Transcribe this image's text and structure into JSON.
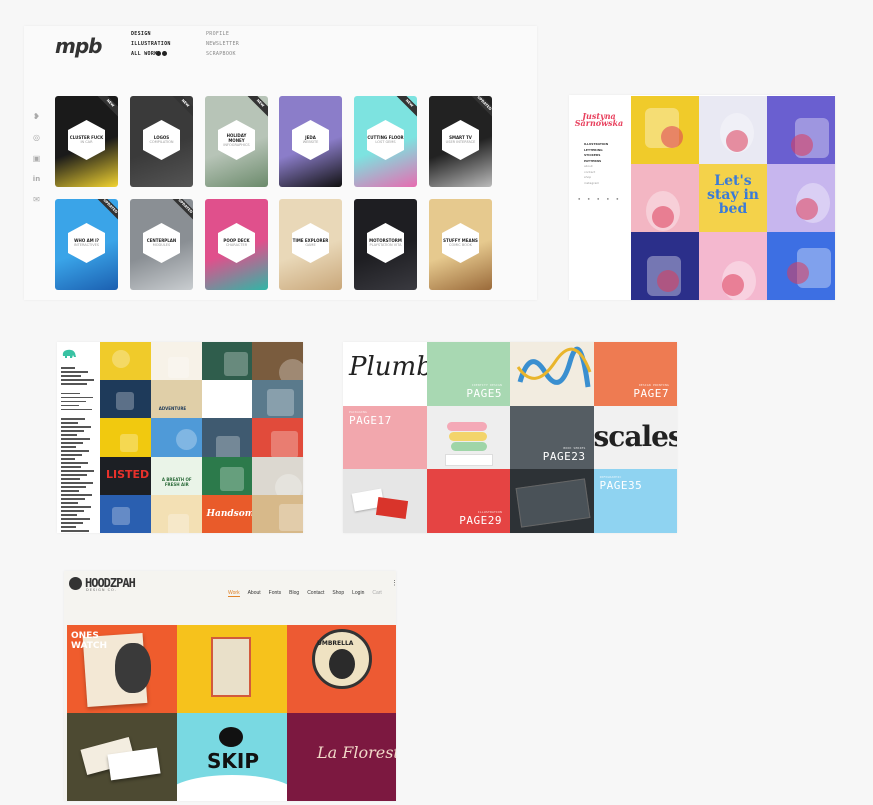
{
  "mpb": {
    "logo": "mpb",
    "nav_left": [
      "DESIGN",
      "ILLUSTRATION",
      "ALL WORK"
    ],
    "nav_right": [
      "PROFILE",
      "NEWSLETTER",
      "SCRAPBOOK"
    ],
    "social_icons": [
      "twitter-icon",
      "dribbble-icon",
      "instagram-icon",
      "linkedin-icon",
      "mail-icon"
    ],
    "tiles": [
      {
        "title": "CLUSTER FUCK",
        "subtitle": "IN CAR",
        "badge": "NEW",
        "color": "#1a1a1a",
        "accent": "#f2d431"
      },
      {
        "title": "LOGOS",
        "subtitle": "COMPILATION",
        "badge": "NEW",
        "color": "#3a3a3a",
        "accent": "#555555"
      },
      {
        "title": "HOLIDAY MONEY",
        "subtitle": "INFOGRAPHICS",
        "badge": "NEW",
        "color": "#b7c4b7",
        "accent": "#6b8a6b"
      },
      {
        "title": "JEDA",
        "subtitle": "WEBSITE",
        "badge": "",
        "color": "#8b7dc9",
        "accent": "#111111"
      },
      {
        "title": "CUTTING FLOOR",
        "subtitle": "LOST GEMS",
        "badge": "NEW",
        "color": "#7de3e0",
        "accent": "#e86bb0"
      },
      {
        "title": "SMART TV",
        "subtitle": "USER INTERFACE",
        "badge": "UPDATED",
        "color": "#222222",
        "accent": "#bbbbbb"
      },
      {
        "title": "WHO AM I?",
        "subtitle": "INTERACTIVES",
        "badge": "UPDATED",
        "color": "#3aa4e8",
        "accent": "#1b5fb0"
      },
      {
        "title": "CENTERPLAN",
        "subtitle": "MODULES",
        "badge": "UPDATED",
        "color": "#8a8f94",
        "accent": "#c9cdd0"
      },
      {
        "title": "POOP DECK",
        "subtitle": "CHARACTER",
        "badge": "",
        "color": "#e0508c",
        "accent": "#2fb7a6"
      },
      {
        "title": "TIME EXPLORER",
        "subtitle": "GAME",
        "badge": "",
        "color": "#e9d8b8",
        "accent": "#c9a77a"
      },
      {
        "title": "MOTORSTORM",
        "subtitle": "PLAYSTATION VITA",
        "badge": "",
        "color": "#1e1e22",
        "accent": "#3a3a40"
      },
      {
        "title": "STUFFY MEANS",
        "subtitle": "COMIC BOOK",
        "badge": "",
        "color": "#e6c98e",
        "accent": "#9a6a3a"
      }
    ]
  },
  "illustrator": {
    "logo": "Justyna Sarnowska",
    "menu": [
      "ILLUSTRATION",
      "LETTERING",
      "STICKERS",
      "PATTERNS",
      "about",
      "contact",
      "shop",
      "instagram"
    ],
    "lettering": "Let's stay in bed",
    "tiles": [
      "#f0cb2a",
      "#e9e9f3",
      "#6a5fd0",
      "#f3b6c3",
      "#f4d24a",
      "#c7b6ee",
      "#2b2f8a",
      "#f4b8cf",
      "#3d6fe3"
    ]
  },
  "grid_site": {
    "tiles": [
      "#f0cb2a",
      "#f7f2e8",
      "#2f5d4c",
      "#7a5c3e",
      "#1e3a5a",
      "#e0cfa8",
      "#ffffff",
      "#5a7a8c",
      "#f1c90f",
      "#4f9ad8",
      "#3f5a70",
      "#e14b3b",
      "#1c1f24",
      "#eaf4e8",
      "#2c7a4b",
      "#dcd8d0",
      "#2a5fb0",
      "#f3e0b4",
      "#e95b2a",
      "#d7b98a"
    ],
    "text_a": "LISTED",
    "text_b": "A BREATH OF FRESH AIR",
    "text_c": "ADVENTURE",
    "text_d": "Handsome"
  },
  "pages": {
    "signature": "Plumbs",
    "word": "scales",
    "items": [
      {
        "label": "PAGE5",
        "color": "#a8d8b2"
      },
      {
        "label": "PAGE7",
        "color": "#ee7b52"
      },
      {
        "label": "PAGE17",
        "color": "#f2a7ad"
      },
      {
        "label": "PAGE23",
        "color": "#555d63"
      },
      {
        "label": "PAGE29",
        "color": "#e54443"
      },
      {
        "label": "PAGE35",
        "color": "#8fd3f1"
      }
    ]
  },
  "hoodzpah": {
    "logo": "HOODZPAH",
    "logo_sub": "DESIGN CO.",
    "nav": [
      "Work",
      "About",
      "Fonts",
      "Blog",
      "Contact",
      "Shop",
      "Login",
      "Cart"
    ],
    "tiles": [
      {
        "text": "ONES WATCH",
        "color": "#ef5c2d"
      },
      {
        "text": "",
        "color": "#f6c21c"
      },
      {
        "text": "UMBRELLA",
        "color": "#ed5a33"
      },
      {
        "text": "",
        "color": "#4d4a32"
      },
      {
        "text": "SKIP",
        "color": "#79d9e2"
      },
      {
        "text": "La Floresta",
        "color": "#7c1840"
      }
    ]
  }
}
